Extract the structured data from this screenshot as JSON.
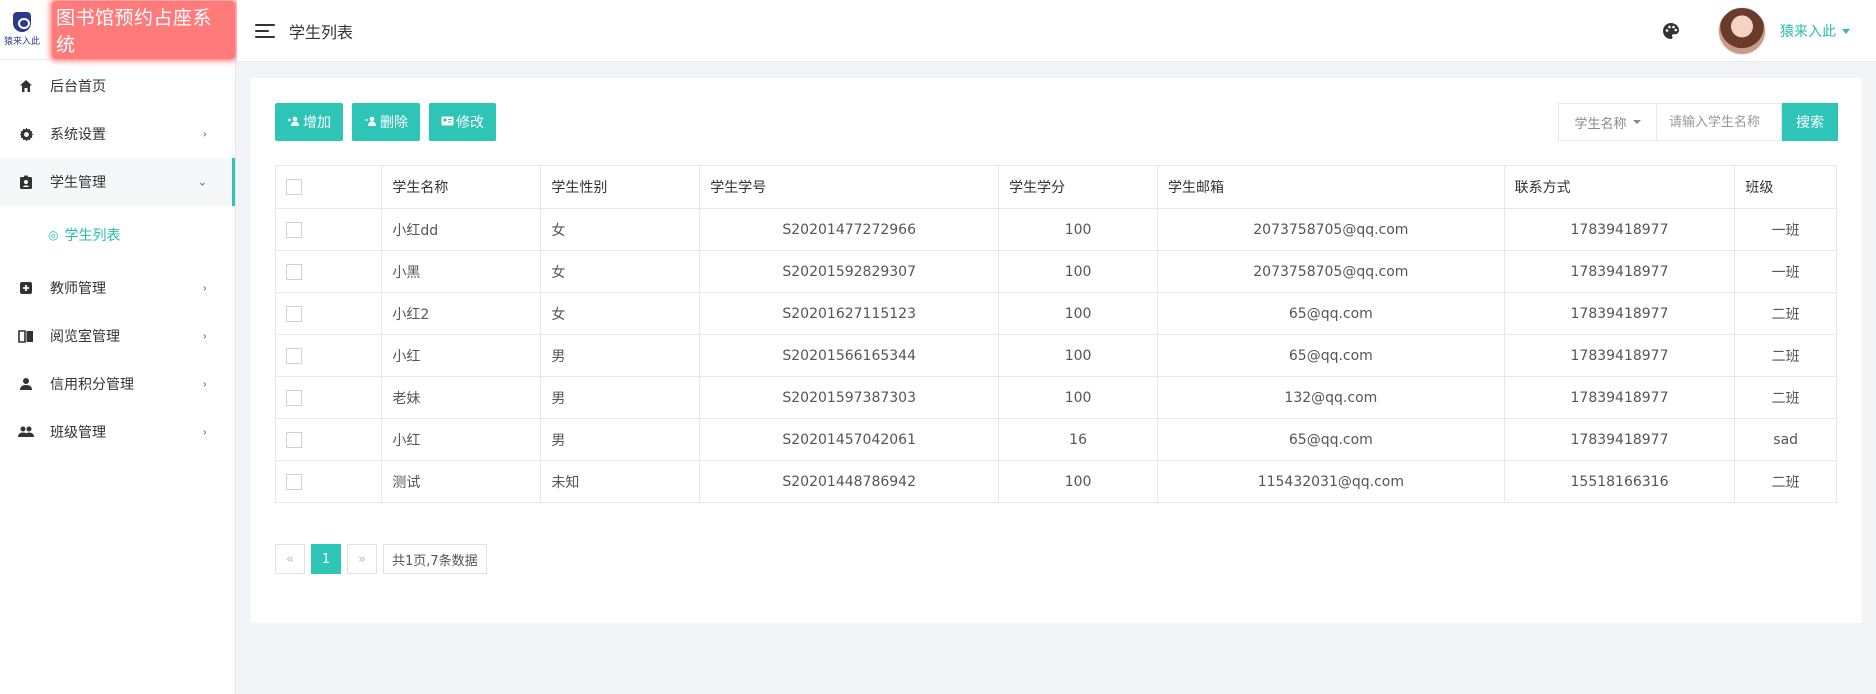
{
  "brand": {
    "logo_text": "猿来入此",
    "title": "图书馆预约占座系统"
  },
  "sidebar": {
    "items": [
      {
        "label": "后台首页",
        "icon": "home-icon",
        "has_children": false,
        "open": false
      },
      {
        "label": "系统设置",
        "icon": "gear-icon",
        "has_children": true,
        "open": false
      },
      {
        "label": "学生管理",
        "icon": "id-badge-icon",
        "has_children": true,
        "open": true,
        "children": [
          {
            "label": "学生列表",
            "icon": "circle-icon"
          }
        ]
      },
      {
        "label": "教师管理",
        "icon": "teacher-icon",
        "has_children": true,
        "open": false
      },
      {
        "label": "阅览室管理",
        "icon": "book-icon",
        "has_children": true,
        "open": false
      },
      {
        "label": "信用积分管理",
        "icon": "user-icon",
        "has_children": true,
        "open": false
      },
      {
        "label": "班级管理",
        "icon": "group-icon",
        "has_children": true,
        "open": false
      }
    ]
  },
  "header": {
    "page_title": "学生列表",
    "username": "猿来入此"
  },
  "toolbar": {
    "add_label": "增加",
    "delete_label": "删除",
    "edit_label": "修改"
  },
  "search": {
    "field_label": "学生名称",
    "placeholder": "请输入学生名称",
    "value": "",
    "button_label": "搜索"
  },
  "table": {
    "columns": [
      "学生名称",
      "学生性别",
      "学生学号",
      "学生学分",
      "学生邮箱",
      "联系方式",
      "班级"
    ],
    "rows": [
      [
        "小红dd",
        "女",
        "S20201477272966",
        "100",
        "2073758705@qq.com",
        "17839418977",
        "一班"
      ],
      [
        "小黑",
        "女",
        "S20201592829307",
        "100",
        "2073758705@qq.com",
        "17839418977",
        "一班"
      ],
      [
        "小红2",
        "女",
        "S20201627115123",
        "100",
        "65@qq.com",
        "17839418977",
        "二班"
      ],
      [
        "小红",
        "男",
        "S20201566165344",
        "100",
        "65@qq.com",
        "17839418977",
        "二班"
      ],
      [
        "老妹",
        "男",
        "S20201597387303",
        "100",
        "132@qq.com",
        "17839418977",
        "二班"
      ],
      [
        "小红",
        "男",
        "S20201457042061",
        "16",
        "65@qq.com",
        "17839418977",
        "sad"
      ],
      [
        "测试",
        "未知",
        "S20201448786942",
        "100",
        "115432031@qq.com",
        "15518166316",
        "二班"
      ]
    ]
  },
  "pagination": {
    "prev": "«",
    "current": "1",
    "next": "»",
    "info": "共1页,7条数据"
  },
  "colors": {
    "accent": "#2ec4b6"
  }
}
